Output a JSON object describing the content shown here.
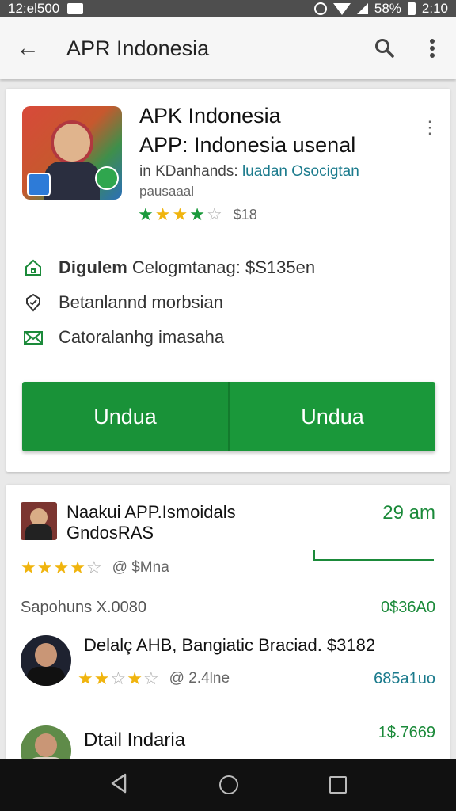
{
  "status_bar": {
    "time_left": "12:el500",
    "battery_pct": "58%",
    "clock": "2:10"
  },
  "toolbar": {
    "back_icon": "arrow-left-icon",
    "title": "APR Indonesia",
    "search_icon": "search-icon",
    "menu_icon": "more-vert-icon"
  },
  "app": {
    "title_line1": "APK Indonesia",
    "title_line2_bold": "APP: Indonesia",
    "title_line2_rest": " usenal",
    "dev_prefix": "in KDanhands:",
    "dev_link": "luadan Osocigtan",
    "subtitle": "pausaaal",
    "rating_count": "$18",
    "rating_stars": 4
  },
  "info": [
    {
      "icon": "home-icon",
      "bold": "Digulem",
      "rest": " Celogmtanag: $S135en"
    },
    {
      "icon": "shield-icon",
      "bold": "",
      "rest": "Betanlannd morbsian"
    },
    {
      "icon": "mail-icon",
      "bold": "",
      "rest": "Catoralanhg imasaha"
    }
  ],
  "install": {
    "left_label": "Undua",
    "right_label": "Undua"
  },
  "list": [
    {
      "title": "Naakui APP.Ismoidals GndosRAS",
      "time": "29 am",
      "stars": 4.5,
      "count": "@ $Mna"
    },
    {
      "section_label": "Sapohuns X.0080",
      "section_price": "0$36A0"
    },
    {
      "title": "Delalç AHB, Bangiatic Braciad. $3182",
      "stars": 3,
      "count": "@ 2.4lne",
      "price": "685a1uo"
    },
    {
      "title": "Dtail Indaria",
      "price": "1$.7669"
    }
  ],
  "colors": {
    "accent_green": "#199238",
    "link_teal": "#1a7a8c"
  }
}
